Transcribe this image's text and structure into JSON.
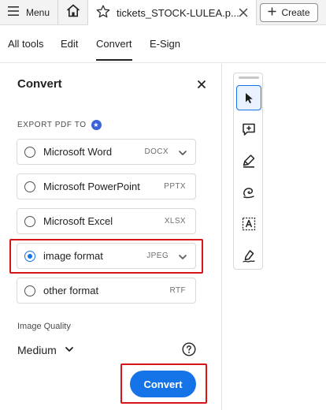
{
  "topbar": {
    "menu_label": "Menu",
    "tab_title": "tickets_STOCK-LULEA.p...",
    "create_label": "Create"
  },
  "tooltabs": [
    {
      "label": "All tools"
    },
    {
      "label": "Edit"
    },
    {
      "label": "Convert",
      "active": true
    },
    {
      "label": "E-Sign"
    }
  ],
  "panel": {
    "title": "Convert",
    "export_label": "EXPORT PDF TO",
    "options": [
      {
        "label": "Microsoft Word",
        "ext": "DOCX",
        "has_dropdown": true,
        "selected": false
      },
      {
        "label": "Microsoft PowerPoint",
        "ext": "PPTX",
        "has_dropdown": false,
        "selected": false
      },
      {
        "label": "Microsoft Excel",
        "ext": "XLSX",
        "has_dropdown": false,
        "selected": false
      },
      {
        "label": "image format",
        "ext": "JPEG",
        "has_dropdown": true,
        "selected": true
      },
      {
        "label": "other format",
        "ext": "RTF",
        "has_dropdown": false,
        "selected": false
      }
    ],
    "quality_label": "Image Quality",
    "quality_value": "Medium",
    "convert_label": "Convert"
  },
  "toolbar": {
    "tools": [
      "select-cursor-icon",
      "add-comment-icon",
      "highlight-pen-icon",
      "draw-freehand-icon",
      "text-select-icon",
      "sign-icon"
    ]
  },
  "colors": {
    "accent": "#1473e6",
    "highlight": "#d7141a"
  }
}
